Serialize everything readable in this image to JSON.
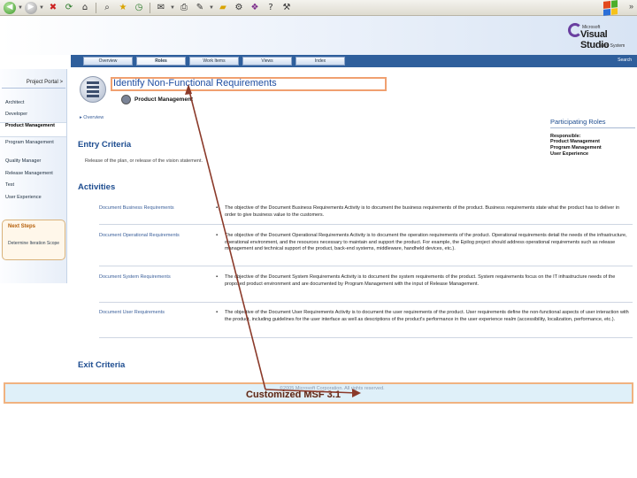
{
  "toolbar": {
    "icons": [
      "back-icon",
      "forward-icon",
      "stop-icon",
      "refresh-icon",
      "home-icon",
      "search-icon",
      "favorites-icon",
      "history-icon",
      "mail-icon",
      "print-icon",
      "edit-icon",
      "folder-icon",
      "settings-icon",
      "help-icon"
    ]
  },
  "banner": {
    "brand_small": "Microsoft",
    "brand_name": "Visual Studio",
    "brand_sub": "Team System"
  },
  "tabs": [
    {
      "label": "Overview",
      "active": false
    },
    {
      "label": "Roles",
      "active": true
    },
    {
      "label": "Work Items",
      "active": false
    },
    {
      "label": "Views",
      "active": false
    },
    {
      "label": "Index",
      "active": false
    }
  ],
  "search_label": "Search",
  "sidebar": {
    "portal_link": "Project Portal >",
    "items": [
      {
        "label": "Architect",
        "active": false
      },
      {
        "label": "Developer",
        "active": false
      },
      {
        "label": "Product Management",
        "active": true
      },
      {
        "label": "Program Management",
        "active": false
      },
      {
        "label": "Quality Manager",
        "active": false
      },
      {
        "label": "Release Management",
        "active": false
      },
      {
        "label": "Test",
        "active": false
      },
      {
        "label": "User Experience",
        "active": false
      }
    ],
    "next_steps_title": "Next Steps",
    "next_steps_item": "Determine Iteration Scope"
  },
  "content": {
    "title": "Identify Non-Functional Requirements",
    "role": "Product Management",
    "overview_link": "Overview",
    "entry_criteria_heading": "Entry Criteria",
    "entry_criteria_text": "Release of the plan, or release of the vision statement.",
    "activities_heading": "Activities",
    "exit_criteria_heading": "Exit Criteria",
    "participating_roles": {
      "title": "Participating Roles",
      "responsible_label": "Responsible:",
      "roles": [
        "Product Management",
        "Program Management",
        "User Experience"
      ]
    },
    "activities": [
      {
        "label": "Document Business Requirements",
        "description": "The objective of the Document Business Requirements Activity is to document the business requirements of the product. Business requirements state what the product has to deliver in order to give business value to the customers."
      },
      {
        "label": "Document Operational Requirements",
        "description": "The objective of the Document Operational Requirements Activity is to document the operation requirements of the product. Operational requirements detail the needs of the infrastructure, operational environment, and the resources necessary to maintain and support the product. For example, the Epilog project should address operational requirements such as release management and technical support of the product, back-end systems, middleware, handheld devices, etc.)."
      },
      {
        "label": "Document System Requirements",
        "description": "The objective of the Document System Requirements Activity is to document the system requirements of the product. System requirements focus on the IT infrastructure needs of the proposed product environment and are documented by Program Management with the input of Release Management."
      },
      {
        "label": "Document User Requirements",
        "description": "The objective of the Document User Requirements Activity is to document the user requirements of the product. User requirements define the non-functional aspects of user interaction with the product, including guidelines for the user interface as well as descriptions of the product's performance in the user experience realm (accessibility, localization, performance, etc.)."
      }
    ]
  },
  "footer": {
    "copyright": "©2005 Microsoft Corporation. All rights reserved.",
    "title": "Customized MSF 3.1"
  },
  "colors": {
    "tab_bar": "#2f5f9c",
    "heading": "#1e4d90",
    "highlight_border": "#f0a070",
    "arrow": "#8b3a2a"
  }
}
